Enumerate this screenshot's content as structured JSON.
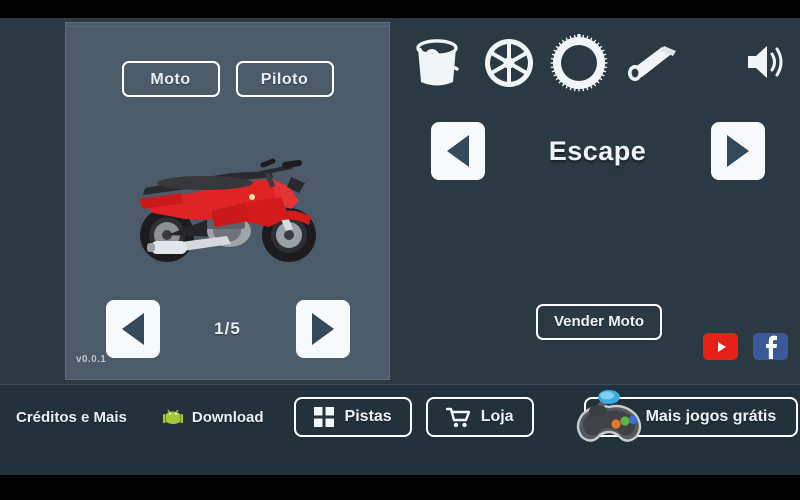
{
  "app": {
    "version_label": "v0.0.1",
    "background_color": "#2b3a42",
    "panel_color": "#4c5b69",
    "bottom_bar_color": "#22313a",
    "accent_color": "#ffffff"
  },
  "left_panel": {
    "tabs": [
      {
        "label": "Moto",
        "name": "tab-moto",
        "selected": true
      },
      {
        "label": "Piloto",
        "name": "tab-piloto",
        "selected": false
      }
    ],
    "preview": {
      "vehicle_name": "moto",
      "vehicle_color": "#e02424",
      "icon": "motorcycle-image"
    },
    "pager": {
      "prev_icon": "triangle-left-icon",
      "next_icon": "triangle-right-icon",
      "counter": "1/5",
      "current": 1,
      "total": 5
    }
  },
  "right_panel": {
    "part_icons": [
      {
        "name": "paint-bucket-icon",
        "label": "Pintura"
      },
      {
        "name": "wheel-rim-icon",
        "label": "Roda"
      },
      {
        "name": "sprocket-icon",
        "label": "Coroa"
      },
      {
        "name": "exhaust-pipe-icon",
        "label": "Escape"
      }
    ],
    "sound": {
      "name": "speaker-on-icon",
      "state": "on"
    },
    "selector": {
      "prev_icon": "triangle-left-icon",
      "next_icon": "triangle-right-icon",
      "current_part": "Escape"
    },
    "sell_button": {
      "label": "Vender Moto"
    },
    "social": [
      {
        "name": "youtube-icon",
        "color": "#e62117"
      },
      {
        "name": "facebook-icon",
        "color": "#3b5998"
      }
    ]
  },
  "bottom_bar": {
    "credits": {
      "label": "Créditos e Mais"
    },
    "download": {
      "label": "Download",
      "icon": "android-icon",
      "icon_color": "#a4c639"
    },
    "tracks": {
      "label": "Pistas",
      "icon": "grid-squares-icon"
    },
    "shop": {
      "label": "Loja",
      "icon": "shopping-cart-icon"
    },
    "more_games": {
      "label": "Mais jogos grátis",
      "icon": "gamepad-icon"
    }
  }
}
